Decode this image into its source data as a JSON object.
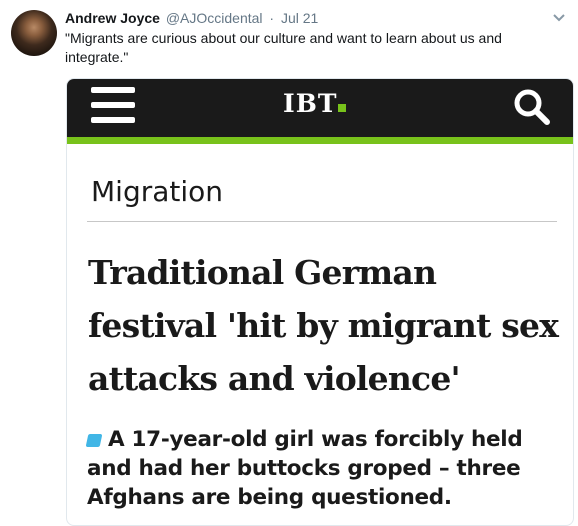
{
  "tweet": {
    "author_name": "Andrew Joyce",
    "handle": "@AJOccidental",
    "separator": "·",
    "time": "Jul 21",
    "text": "\"Migrants are curious about our culture and want to learn about us and integrate.\""
  },
  "media": {
    "site_logo": "IBT",
    "section": "Migration",
    "headline": "Traditional German festival 'hit by migrant sex attacks and violence'",
    "subhead": "A 17-year-old girl was forcibly held and had her buttocks groped – three Afghans are being questioned.",
    "colors": {
      "brand_bar": "#1a1a1a",
      "brand_accent": "#78c21b",
      "bullet": "#41b6e6"
    },
    "icons": {
      "menu": "hamburger-menu-icon",
      "search": "search-icon",
      "bullet": "bullet-icon"
    }
  }
}
